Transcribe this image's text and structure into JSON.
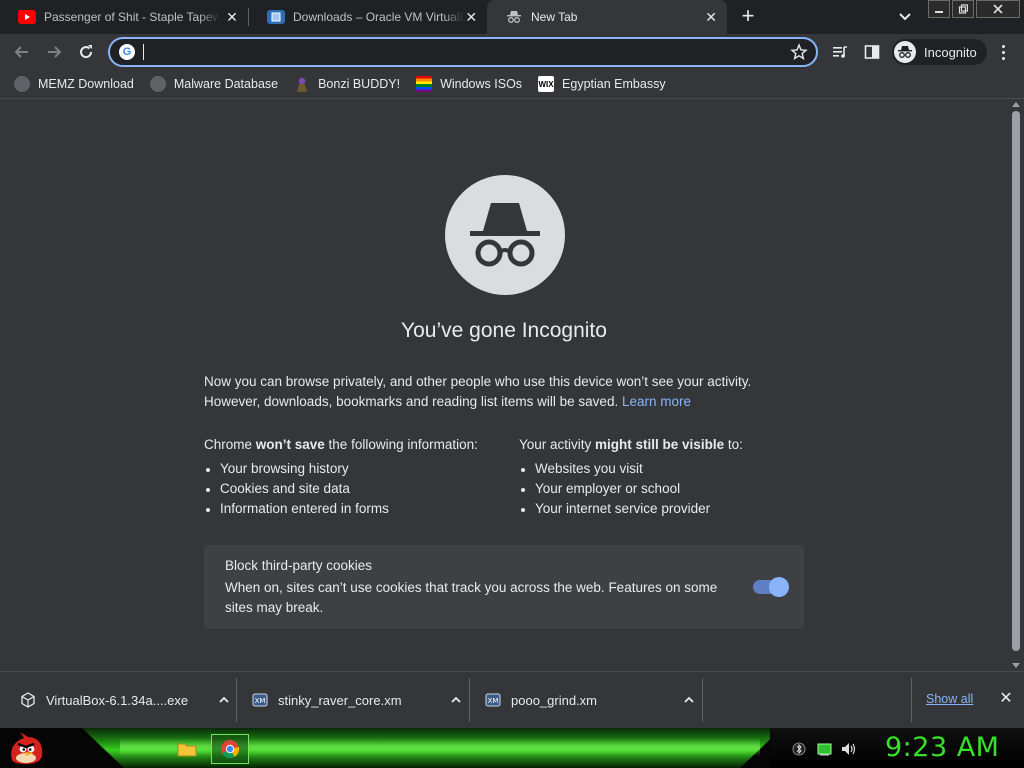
{
  "tabs": [
    {
      "title": "Passenger of Shit - Staple Tapeworm",
      "favicon": "youtube-icon",
      "active": false
    },
    {
      "title": "Downloads – Oracle VM VirtualBox",
      "favicon": "virtualbox-icon",
      "active": false
    },
    {
      "title": "New Tab",
      "favicon": "incognito-icon",
      "active": true
    }
  ],
  "omnibox": {
    "value": "",
    "placeholder": ""
  },
  "profile": {
    "label": "Incognito"
  },
  "bookmarks": [
    {
      "label": "MEMZ Download",
      "icon": "globe-icon"
    },
    {
      "label": "Malware Database",
      "icon": "globe-icon"
    },
    {
      "label": "Bonzi BUDDY!",
      "icon": "bonzi-icon"
    },
    {
      "label": "Windows ISOs",
      "icon": "windows-icon"
    },
    {
      "label": "Egyptian Embassy",
      "icon": "wix-icon"
    }
  ],
  "incognito": {
    "headline": "You’ve gone Incognito",
    "intro_text": "Now you can browse privately, and other people who use this device won’t see your activity. However, downloads, bookmarks and reading list items will be saved.",
    "learn_more": "Learn more",
    "left_header_pre": "Chrome ",
    "left_header_bold": "won’t save",
    "left_header_post": " the following information:",
    "left_items": [
      "Your browsing history",
      "Cookies and site data",
      "Information entered in forms"
    ],
    "right_header_pre": "Your activity ",
    "right_header_bold": "might still be visible",
    "right_header_post": " to:",
    "right_items": [
      "Websites you visit",
      "Your employer or school",
      "Your internet service provider"
    ],
    "cookie_title": "Block third-party cookies",
    "cookie_desc": "When on, sites can’t use cookies that track you across the web. Features on some sites may break.",
    "cookie_enabled": true
  },
  "downloads": {
    "items": [
      {
        "name": "VirtualBox-6.1.34a....exe",
        "icon": "virtualbox-cube-icon"
      },
      {
        "name": "stinky_raver_core.xm",
        "icon": "xm-file-icon"
      },
      {
        "name": "pooo_grind.xm",
        "icon": "xm-file-icon"
      }
    ],
    "show_all": "Show all"
  },
  "taskbar": {
    "clock": "9:23 AM"
  },
  "colors": {
    "accent_blue": "#8ab4f8",
    "clock_green": "#37e02a",
    "page_bg": "#35363a"
  }
}
